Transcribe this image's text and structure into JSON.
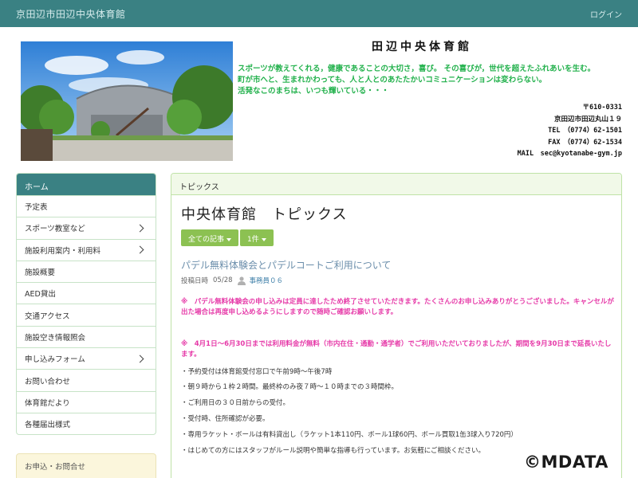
{
  "topbar": {
    "site_title": "京田辺市田辺中央体育館",
    "login": "ログイン"
  },
  "header": {
    "gym_name": "田辺中央体育館",
    "intro": [
      "スポーツが教えてくれる，健康であることの大切さ，喜び。 その喜びが，世代を超えたふれあいを生む。",
      "町が市へと、生まれかわっても、人と人とのあたたかいコミュニケーションは変わらない。",
      "活発なこのまちは、いつも輝いている・・・"
    ],
    "contact": {
      "postal": "〒610-0331",
      "address": "京田辺市田辺丸山１９",
      "tel": "TEL　（0774）62-1501",
      "fax": "FAX　（0774）62-1534",
      "mail": "MAIL　sec@kyotanabe-gym.jp"
    }
  },
  "sidebar": {
    "heading": "ホーム",
    "items": [
      {
        "label": "予定表",
        "has_sub": false
      },
      {
        "label": "スポーツ教室など",
        "has_sub": true
      },
      {
        "label": "施設利用案内・利用料",
        "has_sub": true
      },
      {
        "label": "施設概要",
        "has_sub": false
      },
      {
        "label": "AED貸出",
        "has_sub": false
      },
      {
        "label": "交通アクセス",
        "has_sub": false
      },
      {
        "label": "施設空き情報照会",
        "has_sub": false
      },
      {
        "label": "申し込みフォーム",
        "has_sub": true
      },
      {
        "label": "お問い合わせ",
        "has_sub": false
      },
      {
        "label": "体育館だより",
        "has_sub": false
      },
      {
        "label": "各種届出様式",
        "has_sub": false
      }
    ],
    "box2_heading": "お申込・お問合せ"
  },
  "main": {
    "panel_heading": "トピックス",
    "page_title": "中央体育館　トピックス",
    "filter_all": "全ての記事",
    "filter_count": "1件",
    "article": {
      "title": "パデル無料体験会とパデルコートご利用について",
      "posted_label": "投稿日時",
      "posted_date": "05/28",
      "author": "事務員０６",
      "notice1": "※　パデル無料体験会の申し込みは定員に達したため終了させていただきます。たくさんのお申し込みありがとうございました。キャンセルが出た場合は再度申し込めるようにしますので随時ご確認お願いします。",
      "notice2": "※　4月1日～6月30日までは利用料金が無料（市内在住・通勤・通学者）でご利用いただいておりましたが、期間を9月30日まで延長いたします。",
      "items": [
        "・予約受付は体育館受付窓口で午前9時～午後7時",
        "・朝９時から１枠２時間。最終枠のみ夜７時～１０時までの３時間枠。",
        "・ご利用日の３０日前からの受付。",
        "・受付時、住所確認が必要。",
        "・専用ラケット・ボールは有料貸出し（ラケット1本110円、ボール1球60円、ボール買取1缶3球入り720円）",
        "・はじめての方にはスタッフがルール説明や簡単な指導も行っています。お気軽にご相談ください。"
      ]
    }
  },
  "watermark": "©MDATA",
  "colors": {
    "topbar": "#3a8183",
    "intro_text": "#22b14c",
    "notice_text": "#e63aa8",
    "button": "#8cc152",
    "link": "#6b8eab"
  }
}
